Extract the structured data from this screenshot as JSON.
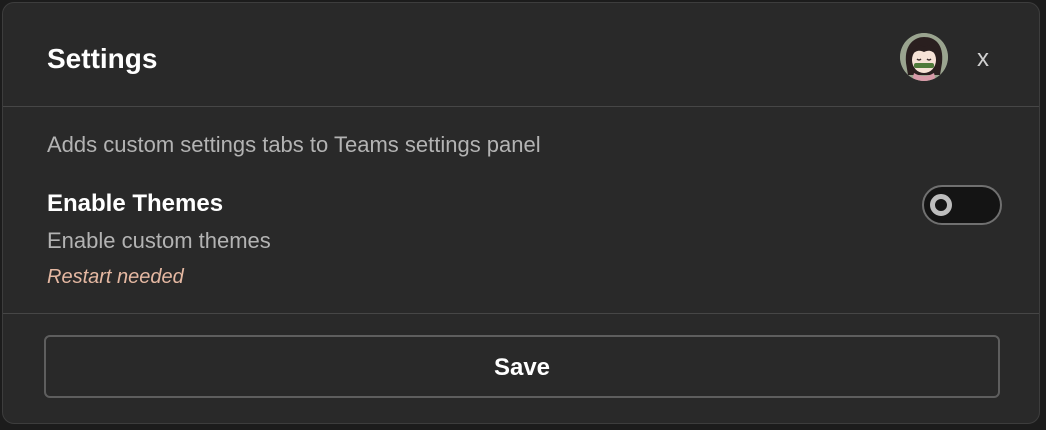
{
  "dialog": {
    "title": "Settings",
    "close_label": "x"
  },
  "plugin": {
    "description": "Adds custom settings tabs to Teams settings panel"
  },
  "setting": {
    "name": "Enable Themes",
    "description": "Enable custom themes",
    "note": "Restart needed",
    "enabled": false
  },
  "footer": {
    "save_label": "Save"
  },
  "colors": {
    "background": "#292929",
    "border": "#464646",
    "note": "#e5b8a2",
    "text_secondary": "#b3b3b3"
  }
}
